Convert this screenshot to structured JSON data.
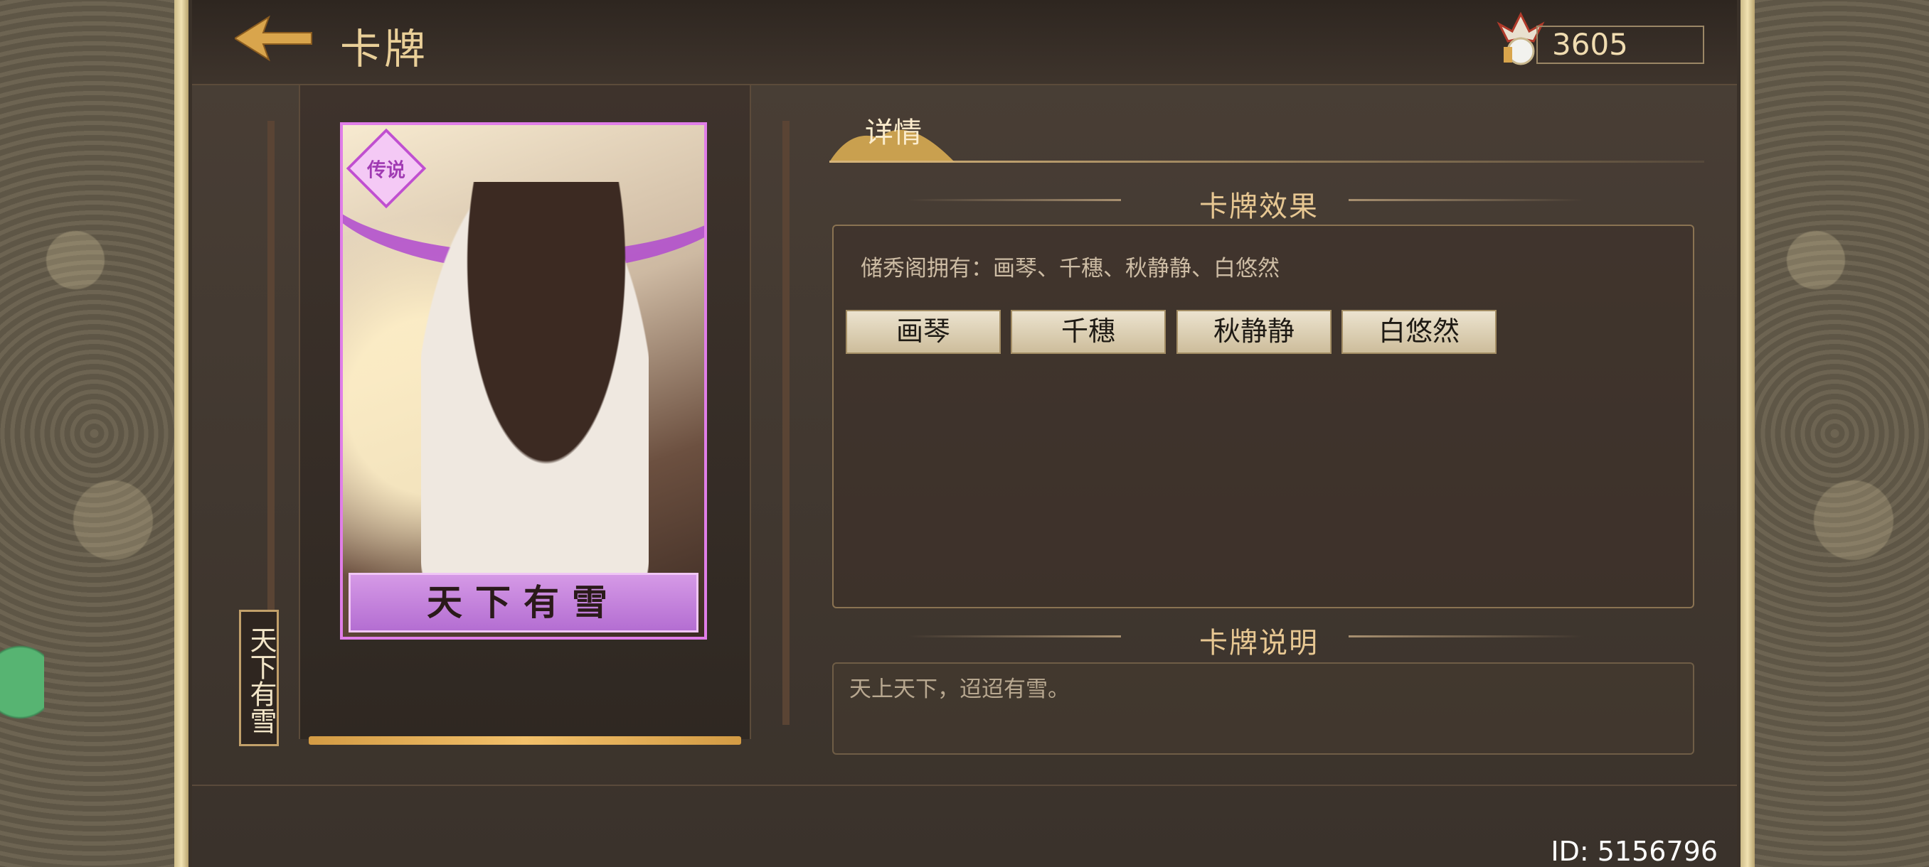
{
  "header": {
    "title": "卡牌",
    "currency_value": "3605"
  },
  "card": {
    "name": "天下有雪",
    "vertical_name": "天下有雪",
    "rarity_badge": "传说"
  },
  "tabs": {
    "details_label": "详情"
  },
  "effect_section": {
    "title": "卡牌效果",
    "text": "储秀阁拥有：画琴、千穗、秋静静、白悠然",
    "members": [
      "画琴",
      "千穗",
      "秋静静",
      "白悠然"
    ]
  },
  "description_section": {
    "title": "卡牌说明",
    "text": "天上天下，迢迢有雪。"
  },
  "footer": {
    "id_text": "ID: 5156796"
  },
  "colors": {
    "accent_gold": "#e7c792",
    "card_frame": "#e07ee8"
  }
}
